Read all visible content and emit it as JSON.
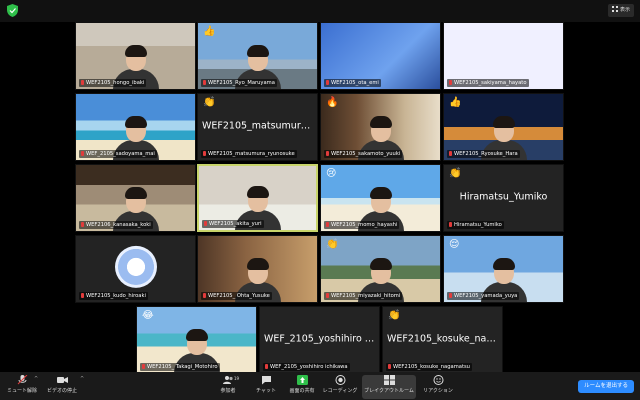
{
  "topbar": {
    "view_label": "表示"
  },
  "tiles": [
    {
      "name": "WEF2105_hongo_ibaki",
      "bg": "bg-room",
      "person": true
    },
    {
      "name": "WEF2105_Ryo_Maruyama",
      "bg": "bg-sky",
      "person": true,
      "reaction": "👍"
    },
    {
      "name": "WEF2105_ota_emi",
      "bg": "bg-toy",
      "person": false
    },
    {
      "name": "WEF2105_sakiyama_hayato",
      "bg": "bg-snow",
      "person": false
    },
    {
      "name": "WEF_2105_sadoyama_mai",
      "bg": "bg-beach",
      "person": true
    },
    {
      "name": "WEF2105_matsumura_ryunosuke",
      "bg": "",
      "person": false,
      "big": "WEF2105_matsumura_ryu...",
      "reaction": "👏"
    },
    {
      "name": "WEF2105_sakamoto_yuuki",
      "bg": "bg-shelf",
      "person": true,
      "reaction": "🔥"
    },
    {
      "name": "WEF2105_Ryosuke_Hara",
      "bg": "bg-night",
      "person": true,
      "reaction": "👍"
    },
    {
      "name": "WEF2106_kanasaka_koki",
      "bg": "bg-cafe",
      "person": true
    },
    {
      "name": "WEF2105_akita_yuri",
      "bg": "bg-light",
      "person": true,
      "speaking": true
    },
    {
      "name": "WEF2105_momo_hayashi",
      "bg": "bg-tropic",
      "person": true,
      "reaction": "😢"
    },
    {
      "name": "Hiramatsu_Yumiko",
      "bg": "",
      "person": false,
      "big": "Hiramatsu_Yumiko",
      "reaction": "👏"
    },
    {
      "name": "WEF2105_kudo_hiroaki",
      "bg": "",
      "person": false,
      "logo": true
    },
    {
      "name": "WEF2105_ Ohta_Yusuke",
      "bg": "bg-wood",
      "person": true
    },
    {
      "name": "WEF2105_miyazaki_hitomi",
      "bg": "bg-mountain",
      "person": true,
      "reaction": "👏"
    },
    {
      "name": "WEF2105_yamada_yuya",
      "bg": "bg-clouds",
      "person": true,
      "reaction": "😌"
    },
    {
      "name": "WEF2105_ Takagi_Motohiro",
      "bg": "bg-shore",
      "person": true,
      "reaction": "😂"
    },
    {
      "name": "WEF_2105_yoshihiro ichikawa",
      "bg": "",
      "person": false,
      "big": "WEF_2105_yoshihiro ichika..."
    },
    {
      "name": "WEF2105_kosuke_nagamatsu",
      "bg": "",
      "person": false,
      "big": "WEF2105_kosuke_nagama...",
      "reaction": "👏"
    }
  ],
  "toolbar": {
    "mute": "ミュート解除",
    "video": "ビデオの停止",
    "participants": "参加者",
    "participants_count": "19",
    "chat": "チャット",
    "share": "画面の共有",
    "record": "レコーディング",
    "breakout": "ブレイクアウトルーム",
    "reactions": "リアクション",
    "end": "ルームを退出する"
  }
}
